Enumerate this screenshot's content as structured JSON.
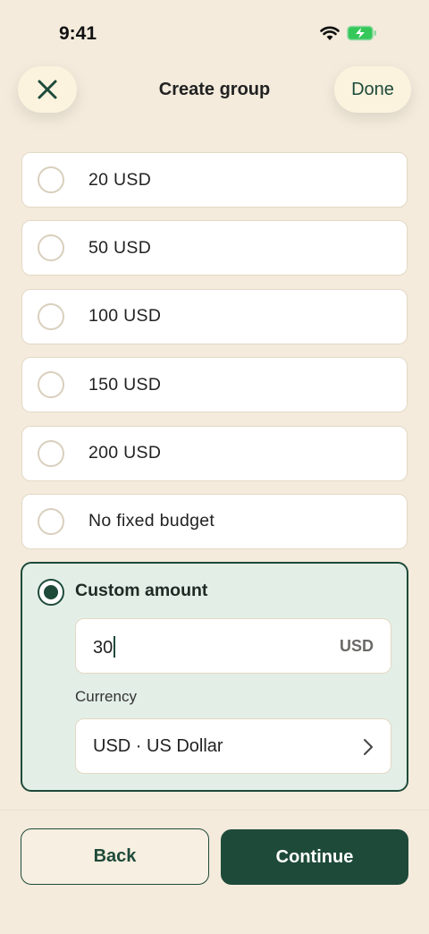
{
  "status_bar": {
    "time": "9:41"
  },
  "nav": {
    "title": "Create group",
    "done_label": "Done"
  },
  "budget_options": [
    {
      "label": "20 USD",
      "selected": false
    },
    {
      "label": "50 USD",
      "selected": false
    },
    {
      "label": "100 USD",
      "selected": false
    },
    {
      "label": "150 USD",
      "selected": false
    },
    {
      "label": "200 USD",
      "selected": false
    },
    {
      "label": "No fixed budget",
      "selected": false
    }
  ],
  "custom": {
    "label": "Custom amount",
    "selected": true,
    "amount_value": "30",
    "amount_unit": "USD",
    "currency_label": "Currency",
    "currency_value": "USD · US Dollar"
  },
  "footer": {
    "back_label": "Back",
    "continue_label": "Continue"
  },
  "colors": {
    "accent": "#1e4a3a",
    "background": "#f4ebdc",
    "selected_card": "#e3efe6",
    "pill": "#fbf3de"
  }
}
